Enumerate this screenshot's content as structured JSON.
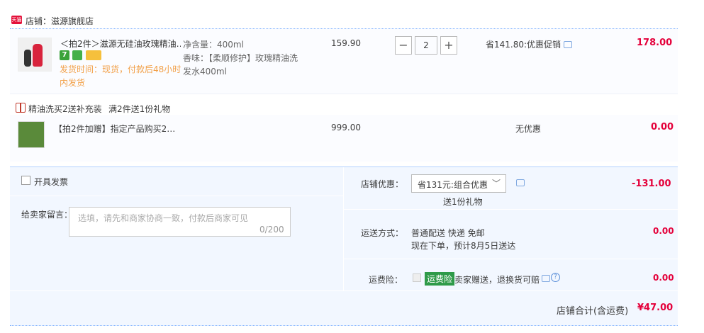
{
  "shop": {
    "badge": "天猫",
    "label": "店铺：滋源旗舰店"
  },
  "product": {
    "title": "＜拍2件＞滋源无硅油玫瑰精油…",
    "tag_seven": "7",
    "shipping_line1": "发货时间：现货，付款后48小时",
    "shipping_line2": "内发货",
    "spec_volume": "净含量：400ml",
    "spec_scent_line1": "香味：【柔顺修护】玫瑰精油洗",
    "spec_scent_line2": "发水400ml",
    "unit_price": "159.90",
    "quantity": "2",
    "minus": "−",
    "plus": "+",
    "promo": "省141.80:优惠促销",
    "total": "178.00"
  },
  "gift": {
    "title": "精油洗买2送补充装",
    "rule": "满2件送1份礼物",
    "name": "【拍2件加赠】指定产品购买2…",
    "price": "999.00",
    "promo": "无优惠",
    "total": "0.00"
  },
  "order": {
    "invoice_label": "开具发票",
    "message_label": "给卖家留言：",
    "message_placeholder": "选填，请先和商家协商一致，付款后商家可见",
    "message_count": "0/200",
    "store_discount_label": "店铺优惠：",
    "store_discount_selected": "省131元:组合优惠",
    "store_discount_amount": "-131.00",
    "gift_note": "送1份礼物",
    "shipping_label": "运送方式：",
    "shipping_method": "普通配送 快递 免邮",
    "shipping_eta": "现在下单，预计8月5日送达",
    "shipping_fee": "0.00",
    "insurance_label": "运费险：",
    "insurance_badge": "运费险",
    "insurance_text": "卖家赠送，退换货可赔",
    "insurance_fee": "0.00",
    "total_label": "店铺合计(含运费)",
    "total_amount": "¥47.00"
  },
  "colors": {
    "accent_red": "#e4003a",
    "orange": "#f2a048",
    "panel_blue": "#f2f7ff",
    "green": "#2e9a49"
  }
}
